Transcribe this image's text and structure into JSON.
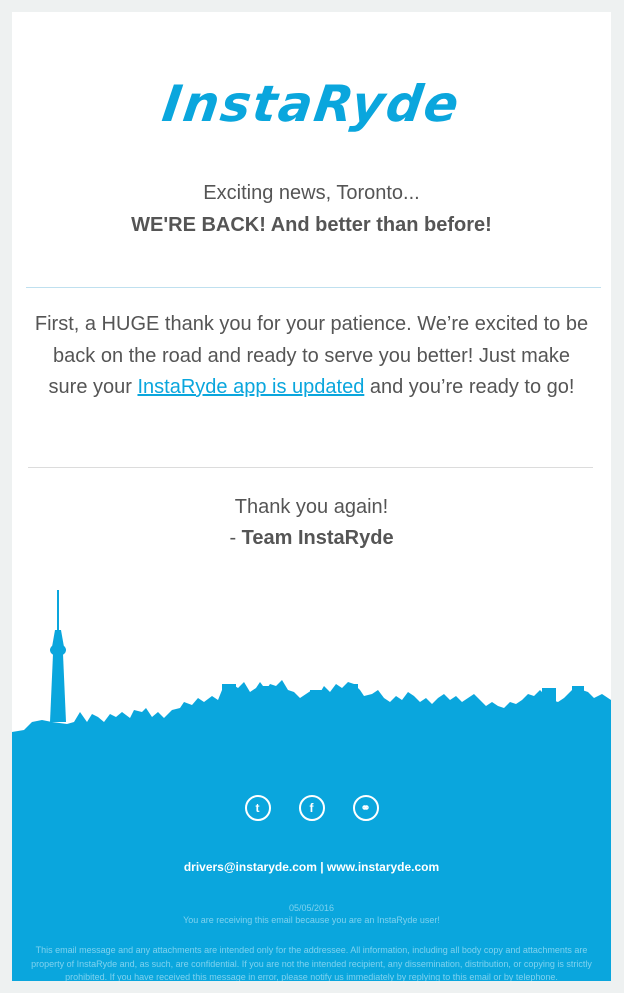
{
  "brand": {
    "logo_text": "InstaRyde",
    "color": "#0aa6dd"
  },
  "intro": {
    "line1": "Exciting news, Toronto...",
    "line2": "WE'RE BACK! And better than before!"
  },
  "body": {
    "part1": "First, a HUGE thank you for your patience. We’re excited to be back on the road and ready to serve you better! Just make sure your ",
    "link": "InstaRyde app is updated",
    "part2": " and you’re ready to go!"
  },
  "signoff": {
    "thanks": "Thank you again!",
    "dash": "- ",
    "team": "Team InstaRyde"
  },
  "footer": {
    "social": [
      {
        "icon": "twitter-icon",
        "glyph": "t"
      },
      {
        "icon": "facebook-icon",
        "glyph": "f"
      },
      {
        "icon": "link-icon",
        "glyph": "⚭"
      }
    ],
    "contact": "drivers@instaryde.com | www.instaryde.com",
    "date": "05/05/2016",
    "reason": "You are receiving this email because you are an InstaRyde user!",
    "legal": "This email message and any attachments are intended only for the addressee. All information, including all body copy and attachments are property of InstaRyde and, as such, are confidential. If you are not the intended recipient, any dissemination, distribution, or copying is strictly prohibited. If you have received this message in error, please notify us immediately by replying to this email or by telephone."
  }
}
